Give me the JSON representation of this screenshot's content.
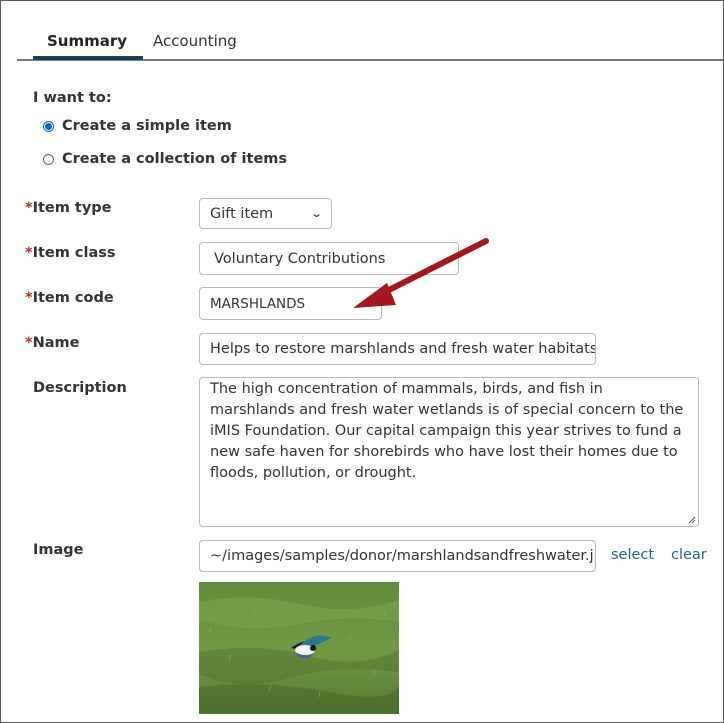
{
  "tabs": [
    {
      "label": "Summary",
      "active": true
    },
    {
      "label": "Accounting",
      "active": false
    }
  ],
  "intent": {
    "label": "I want to:",
    "options": [
      {
        "label": "Create a simple item",
        "selected": true
      },
      {
        "label": "Create a collection of items",
        "selected": false
      }
    ]
  },
  "form": {
    "required_marker": "*",
    "item_type": {
      "label": "Item type",
      "value": "Gift item"
    },
    "item_class": {
      "label": "Item class",
      "value": "Voluntary Contributions"
    },
    "item_code": {
      "label": "Item code",
      "value": "MARSHLANDS"
    },
    "name": {
      "label": "Name",
      "value": "Helps to restore marshlands and fresh water habitats"
    },
    "description": {
      "label": "Description",
      "value": "The high concentration of mammals, birds, and fish in marshlands and fresh water wetlands is of special concern to the iMIS Foundation. Our capital campaign this year strives to fund a new safe haven for shorebirds who have lost their homes due to floods, pollution, or drought."
    },
    "image": {
      "label": "Image",
      "value": "~/images/samples/donor/marshlandsandfreshwater.jpg",
      "select_label": "select",
      "clear_label": "clear"
    }
  },
  "colors": {
    "tab_underline": "#14424f",
    "required": "#c0292b",
    "link": "#1a6a8a",
    "arrow": "#a3181f"
  }
}
